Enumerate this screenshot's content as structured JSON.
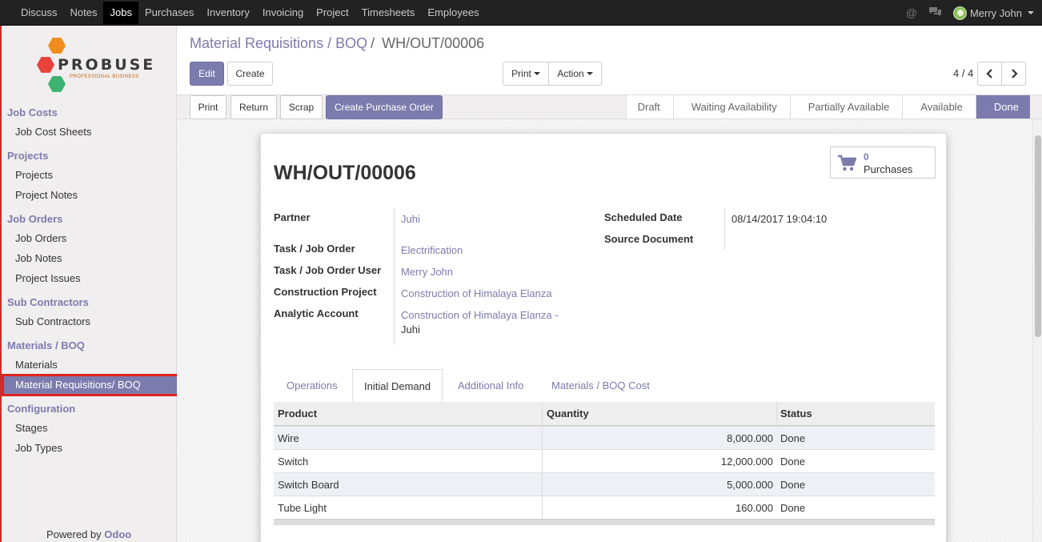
{
  "topbar": {
    "menu": [
      "Discuss",
      "Notes",
      "Jobs",
      "Purchases",
      "Inventory",
      "Invoicing",
      "Project",
      "Timesheets",
      "Employees"
    ],
    "active": "Jobs",
    "user": "Merry John"
  },
  "logo": {
    "word": "PROBUSE",
    "tagline": "PROFESSIONAL BUSINESS"
  },
  "sidebar": {
    "sections": [
      {
        "title": "Job Costs",
        "items": [
          "Job Cost Sheets"
        ]
      },
      {
        "title": "Projects",
        "items": [
          "Projects",
          "Project Notes"
        ]
      },
      {
        "title": "Job Orders",
        "items": [
          "Job Orders",
          "Job Notes",
          "Project Issues"
        ]
      },
      {
        "title": "Sub Contractors",
        "items": [
          "Sub Contractors"
        ]
      },
      {
        "title": "Materials / BOQ",
        "items": [
          "Materials",
          "Material Requisitions/ BOQ"
        ]
      },
      {
        "title": "Configuration",
        "items": [
          "Stages",
          "Job Types"
        ]
      }
    ],
    "active_item": "Material Requisitions/ BOQ",
    "powered_prefix": "Powered by",
    "powered_brand": "Odoo"
  },
  "breadcrumb": {
    "parent": "Material Requisitions / BOQ",
    "separator": "/",
    "current": "WH/OUT/00006"
  },
  "toolbar": {
    "edit": "Edit",
    "create": "Create",
    "print": "Print",
    "action": "Action"
  },
  "pager": {
    "text": "4 / 4"
  },
  "status_buttons": [
    "Print",
    "Return",
    "Scrap",
    "Create Purchase Order"
  ],
  "stages": [
    "Draft",
    "Waiting Availability",
    "Partially Available",
    "Available",
    "Done"
  ],
  "current_stage": "Done",
  "smart_button": {
    "count": "0",
    "label": "Purchases"
  },
  "record": {
    "title": "WH/OUT/00006",
    "partner_label": "Partner",
    "partner": "Juhi",
    "task_label": "Task / Job Order",
    "task": "Electrification",
    "task_user_label": "Task / Job Order User",
    "task_user": "Merry John",
    "construction_label": "Construction Project",
    "construction": "Construction of Himalaya Elanza",
    "analytic_label": "Analytic Account",
    "analytic_line1": "Construction of Himalaya Elanza -",
    "analytic_line2": "Juhi",
    "scheduled_label": "Scheduled Date",
    "scheduled": "08/14/2017 19:04:10",
    "source_label": "Source Document"
  },
  "tabs": [
    "Operations",
    "Initial Demand",
    "Additional Info",
    "Materials / BOQ Cost"
  ],
  "active_tab": "Initial Demand",
  "table": {
    "columns": [
      "Product",
      "Quantity",
      "Status"
    ],
    "rows": [
      [
        "Wire",
        "8,000.000",
        "Done"
      ],
      [
        "Switch",
        "12,000.000",
        "Done"
      ],
      [
        "Switch Board",
        "5,000.000",
        "Done"
      ],
      [
        "Tube Light",
        "160.000",
        "Done"
      ]
    ]
  },
  "colors": {
    "primary": "#7c7bad",
    "navbar": "#222222",
    "highlight": "#e0241f"
  }
}
